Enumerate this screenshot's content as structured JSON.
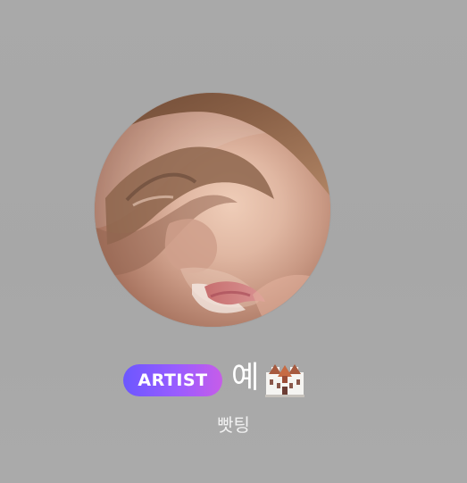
{
  "profile": {
    "badge_label": "ARTIST",
    "display_name": "예",
    "name_icon": "castle-icon",
    "subtitle": "빳팅"
  },
  "colors": {
    "background": "#A8A8A8",
    "badge_start": "#6C57FF",
    "badge_end": "#C65DE9",
    "text": "#FFFFFF"
  }
}
